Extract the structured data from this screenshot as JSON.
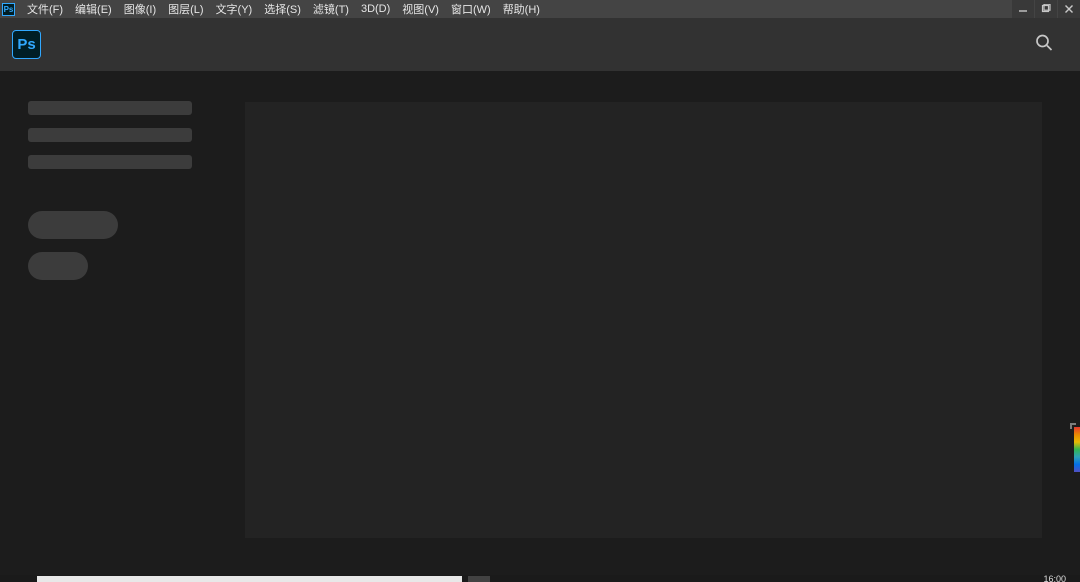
{
  "menubar": {
    "ps_badge": "Ps",
    "items": [
      {
        "label": "文件(F)"
      },
      {
        "label": "编辑(E)"
      },
      {
        "label": "图像(I)"
      },
      {
        "label": "图层(L)"
      },
      {
        "label": "文字(Y)"
      },
      {
        "label": "选择(S)"
      },
      {
        "label": "滤镜(T)"
      },
      {
        "label": "3D(D)"
      },
      {
        "label": "视图(V)"
      },
      {
        "label": "窗口(W)"
      },
      {
        "label": "帮助(H)"
      }
    ]
  },
  "optionsbar": {
    "logo_text": "Ps"
  },
  "taskbar": {
    "clock": "16:00"
  }
}
